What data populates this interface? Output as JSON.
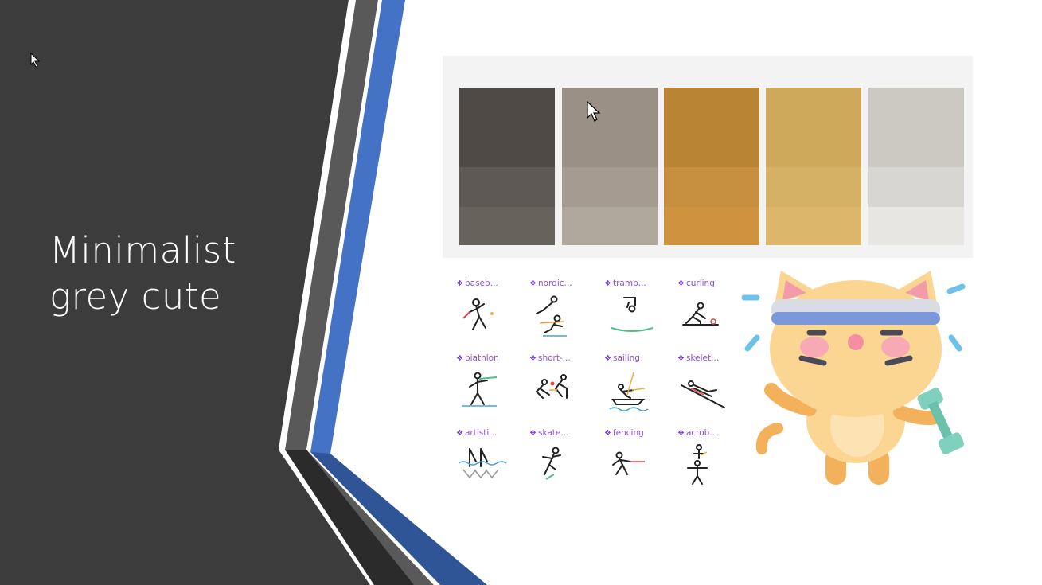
{
  "slide": {
    "title_line1": "Minimalist",
    "title_line2": "grey cute"
  },
  "colors": {
    "panel_dark": "#3c3c3c",
    "stripe_grey": "#5a5a5a",
    "stripe_blue": "#4472c4",
    "stripe_blue_dark": "#2f5597",
    "accent_purple": "#8a4fd9"
  },
  "palette": {
    "swatches": [
      {
        "top": "#4f4a46",
        "mid": "#5e5955",
        "bottom": "#68625d"
      },
      {
        "top": "#9b9085",
        "mid": "#a59b90",
        "bottom": "#b0a79d"
      },
      {
        "top": "#b98535",
        "mid": "#c58f3e",
        "bottom": "#cf933f"
      },
      {
        "top": "#cfa95b",
        "mid": "#d5b165",
        "bottom": "#dcb76b"
      },
      {
        "top": "#ccc9c3",
        "mid": "#d8d6d2",
        "bottom": "#e7e6e3"
      }
    ]
  },
  "icons": [
    {
      "label": "baseb...",
      "icon": "baseball-icon"
    },
    {
      "label": "nordic...",
      "icon": "nordic-combined-icon"
    },
    {
      "label": "tramp...",
      "icon": "trampoline-icon"
    },
    {
      "label": "curling",
      "icon": "curling-icon"
    },
    {
      "label": "biathlon",
      "icon": "biathlon-icon"
    },
    {
      "label": "short-...",
      "icon": "short-track-icon"
    },
    {
      "label": "sailing",
      "icon": "sailing-icon"
    },
    {
      "label": "skelet...",
      "icon": "skeleton-icon"
    },
    {
      "label": "artisti...",
      "icon": "artistic-swimming-icon"
    },
    {
      "label": "skate...",
      "icon": "skateboarding-icon"
    },
    {
      "label": "fencing",
      "icon": "fencing-icon"
    },
    {
      "label": "acrob...",
      "icon": "acrobatic-icon"
    }
  ],
  "illustration": {
    "icon": "cat-with-dumbbell-icon"
  }
}
